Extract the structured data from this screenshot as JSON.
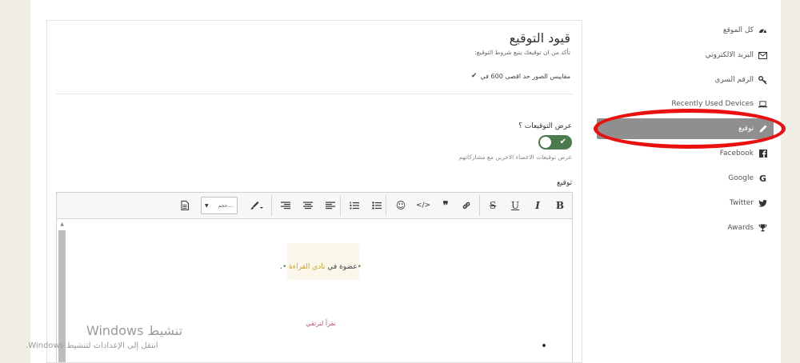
{
  "page": {
    "title": "قيود التوقيع",
    "subtitle": "تأكد من ان توقيعك يتبع شروط التوقيع:",
    "rule": "مقاييس الصور حد اقصى 600 في",
    "show_signatures_label": "عرض التوقيعات ؟",
    "toggle_state": "on",
    "show_signatures_help": "عرض توقيعات الاعضاء الاخرين مع مشاركاتهم",
    "signature_label": "توقيع"
  },
  "editor": {
    "font_select_value": "حجم....",
    "content_line1_prefix": "عضوة في",
    "content_line1_club": "نادي القراءة",
    "content_line2": "نقرأ لنرتقي"
  },
  "sidebar": {
    "items": [
      {
        "label": "كل الموقع",
        "icon": "dashboard-icon",
        "active": false
      },
      {
        "label": "البريد الالكتروني",
        "icon": "envelope-icon",
        "active": false
      },
      {
        "label": "الرقم السري",
        "icon": "key-icon",
        "active": false
      },
      {
        "label": "Recently Used Devices",
        "icon": "laptop-icon",
        "active": false
      },
      {
        "label": "توقيع",
        "icon": "pencil-icon",
        "active": true
      },
      {
        "label": "Facebook",
        "icon": "facebook-icon",
        "active": false
      },
      {
        "label": "Google",
        "icon": "google-icon",
        "active": false
      },
      {
        "label": "Twitter",
        "icon": "twitter-icon",
        "active": false
      },
      {
        "label": "Awards",
        "icon": "trophy-icon",
        "active": false
      }
    ]
  },
  "watermark": {
    "title": "تنشيط Windows",
    "subtitle": "انتقل إلى الإعدادات لتنشيط Windows."
  },
  "colors": {
    "accent_green": "#4a7a4e",
    "active_nav": "#8f8f8f",
    "annotation_red": "#ea1010",
    "club_gold": "#c9a227",
    "motto_pink": "#d14f73"
  }
}
